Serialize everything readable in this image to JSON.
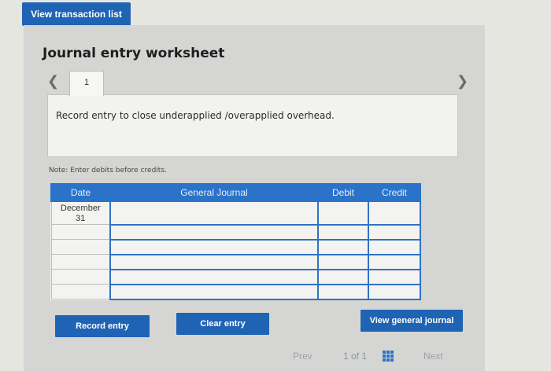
{
  "header": {
    "view_transactions_label": "View transaction list"
  },
  "worksheet": {
    "title": "Journal entry worksheet",
    "tab_number": "1",
    "prev_icon": "chevron-left-icon",
    "next_icon": "chevron-right-icon",
    "description": "Record entry to close underapplied /overapplied overhead.",
    "note": "Note: Enter debits before credits."
  },
  "table": {
    "columns": [
      "Date",
      "General Journal",
      "Debit",
      "Credit"
    ],
    "rows": [
      {
        "date": "December\n31",
        "account": "",
        "debit": "",
        "credit": ""
      },
      {
        "date": "",
        "account": "",
        "debit": "",
        "credit": ""
      },
      {
        "date": "",
        "account": "",
        "debit": "",
        "credit": ""
      },
      {
        "date": "",
        "account": "",
        "debit": "",
        "credit": ""
      },
      {
        "date": "",
        "account": "",
        "debit": "",
        "credit": ""
      },
      {
        "date": "",
        "account": "",
        "debit": "",
        "credit": ""
      }
    ]
  },
  "actions": {
    "record_label": "Record entry",
    "clear_label": "Clear entry",
    "view_journal_label": "View general journal"
  },
  "pagination": {
    "prev_label": "Prev",
    "page_current": "1",
    "page_of": "of",
    "page_total": "1",
    "next_label": "Next",
    "grid_icon": "grid-icon"
  },
  "colors": {
    "accent": "#1f63b4",
    "table_header": "#2a73c8"
  }
}
